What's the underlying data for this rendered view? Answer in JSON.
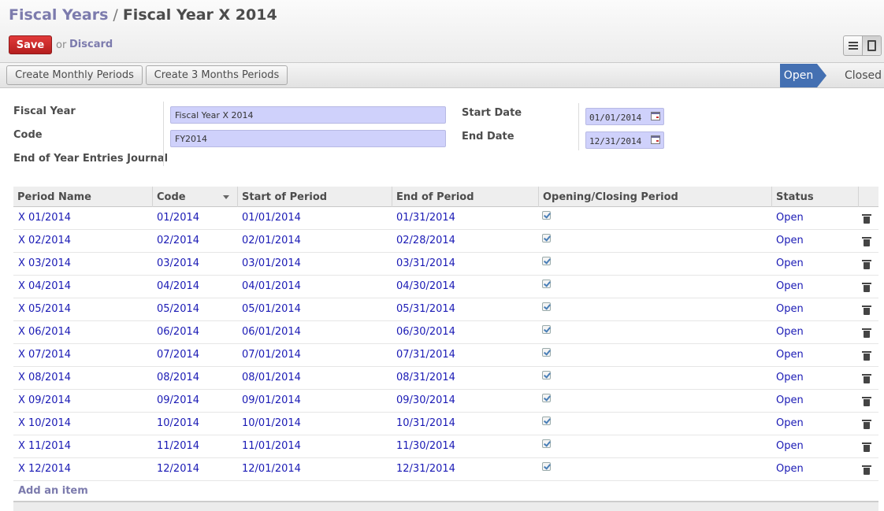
{
  "breadcrumb": {
    "parent": "Fiscal Years",
    "separator": "/",
    "current": "Fiscal Year X 2014"
  },
  "toolbar": {
    "save_label": "Save",
    "or_text": "or",
    "discard_label": "Discard"
  },
  "statusbar": {
    "buttons": [
      "Create Monthly Periods",
      "Create 3 Months Periods"
    ],
    "states": {
      "active": "Open",
      "next": "Closed"
    },
    "active_color": "#4470b2"
  },
  "form": {
    "fiscal_year_label": "Fiscal Year",
    "fiscal_year_value": "Fiscal Year X 2014",
    "code_label": "Code",
    "code_value": "FY2014",
    "journal_label": "End of Year Entries Journal",
    "start_date_label": "Start Date",
    "start_date_value": "01/01/2014",
    "end_date_label": "End Date",
    "end_date_value": "12/31/2014"
  },
  "table": {
    "columns": [
      "Period Name",
      "Code",
      "Start of Period",
      "End of Period",
      "Opening/Closing Period",
      "Status"
    ],
    "rows": [
      {
        "name": "X 01/2014",
        "code": "01/2014",
        "start": "01/01/2014",
        "end": "01/31/2014",
        "opening_closing": true,
        "status": "Open"
      },
      {
        "name": "X 02/2014",
        "code": "02/2014",
        "start": "02/01/2014",
        "end": "02/28/2014",
        "opening_closing": true,
        "status": "Open"
      },
      {
        "name": "X 03/2014",
        "code": "03/2014",
        "start": "03/01/2014",
        "end": "03/31/2014",
        "opening_closing": true,
        "status": "Open"
      },
      {
        "name": "X 04/2014",
        "code": "04/2014",
        "start": "04/01/2014",
        "end": "04/30/2014",
        "opening_closing": true,
        "status": "Open"
      },
      {
        "name": "X 05/2014",
        "code": "05/2014",
        "start": "05/01/2014",
        "end": "05/31/2014",
        "opening_closing": true,
        "status": "Open"
      },
      {
        "name": "X 06/2014",
        "code": "06/2014",
        "start": "06/01/2014",
        "end": "06/30/2014",
        "opening_closing": true,
        "status": "Open"
      },
      {
        "name": "X 07/2014",
        "code": "07/2014",
        "start": "07/01/2014",
        "end": "07/31/2014",
        "opening_closing": true,
        "status": "Open"
      },
      {
        "name": "X 08/2014",
        "code": "08/2014",
        "start": "08/01/2014",
        "end": "08/31/2014",
        "opening_closing": true,
        "status": "Open"
      },
      {
        "name": "X 09/2014",
        "code": "09/2014",
        "start": "09/01/2014",
        "end": "09/30/2014",
        "opening_closing": true,
        "status": "Open"
      },
      {
        "name": "X 10/2014",
        "code": "10/2014",
        "start": "10/01/2014",
        "end": "10/31/2014",
        "opening_closing": true,
        "status": "Open"
      },
      {
        "name": "X 11/2014",
        "code": "11/2014",
        "start": "11/01/2014",
        "end": "11/30/2014",
        "opening_closing": true,
        "status": "Open"
      },
      {
        "name": "X 12/2014",
        "code": "12/2014",
        "start": "12/01/2014",
        "end": "12/31/2014",
        "opening_closing": true,
        "status": "Open"
      }
    ],
    "add_item_label": "Add an item"
  },
  "icons": {
    "list_view": "list-view-icon",
    "form_view": "form-view-icon",
    "calendar": "calendar-icon",
    "delete": "trash-icon",
    "sort": "sort-caret-icon",
    "checkbox": "checkbox-checked-icon"
  },
  "colors": {
    "link": "#7c7bad",
    "row_text": "#1a1ab5",
    "save": "#c92a2a",
    "field_bg": "#cfd1fb"
  }
}
